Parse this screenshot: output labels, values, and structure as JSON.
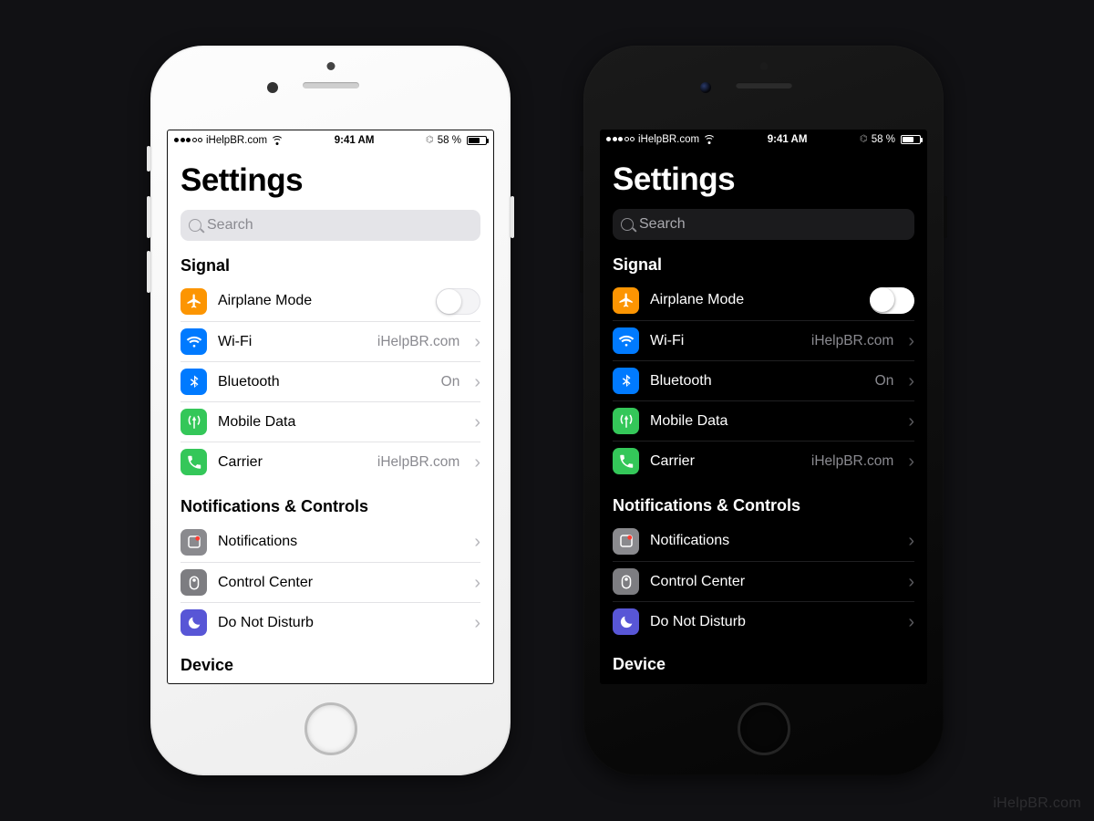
{
  "watermark": "iHelpBR.com",
  "status": {
    "carrier": "iHelpBR.com",
    "time": "9:41 AM",
    "battery_pct": "58 %",
    "signal_filled": 3,
    "signal_total": 5
  },
  "page": {
    "title": "Settings",
    "search_placeholder": "Search"
  },
  "sections": [
    {
      "header": "Signal",
      "rows": [
        {
          "icon": "airplane",
          "color": "ic-orange",
          "label": "Airplane Mode",
          "control": "toggle"
        },
        {
          "icon": "wifi",
          "color": "ic-blue",
          "label": "Wi-Fi",
          "value": "iHelpBR.com",
          "control": "disclosure"
        },
        {
          "icon": "bluetooth",
          "color": "ic-blue",
          "label": "Bluetooth",
          "value": "On",
          "control": "disclosure"
        },
        {
          "icon": "antenna",
          "color": "ic-green",
          "label": "Mobile Data",
          "control": "disclosure"
        },
        {
          "icon": "phone",
          "color": "ic-phone",
          "label": "Carrier",
          "value": "iHelpBR.com",
          "control": "disclosure"
        }
      ]
    },
    {
      "header": "Notifications & Controls",
      "rows": [
        {
          "icon": "notify",
          "color": "ic-gray",
          "label": "Notifications",
          "control": "disclosure"
        },
        {
          "icon": "control",
          "color": "ic-gray2",
          "label": "Control Center",
          "control": "disclosure"
        },
        {
          "icon": "moon",
          "color": "ic-purple",
          "label": "Do Not Disturb",
          "control": "disclosure"
        }
      ]
    },
    {
      "header": "Device",
      "rows": []
    }
  ],
  "colors": {
    "orange": "#fc9502",
    "blue": "#007aff",
    "green": "#34c759",
    "gray": "#8a8a8e",
    "purple": "#5856d6"
  }
}
